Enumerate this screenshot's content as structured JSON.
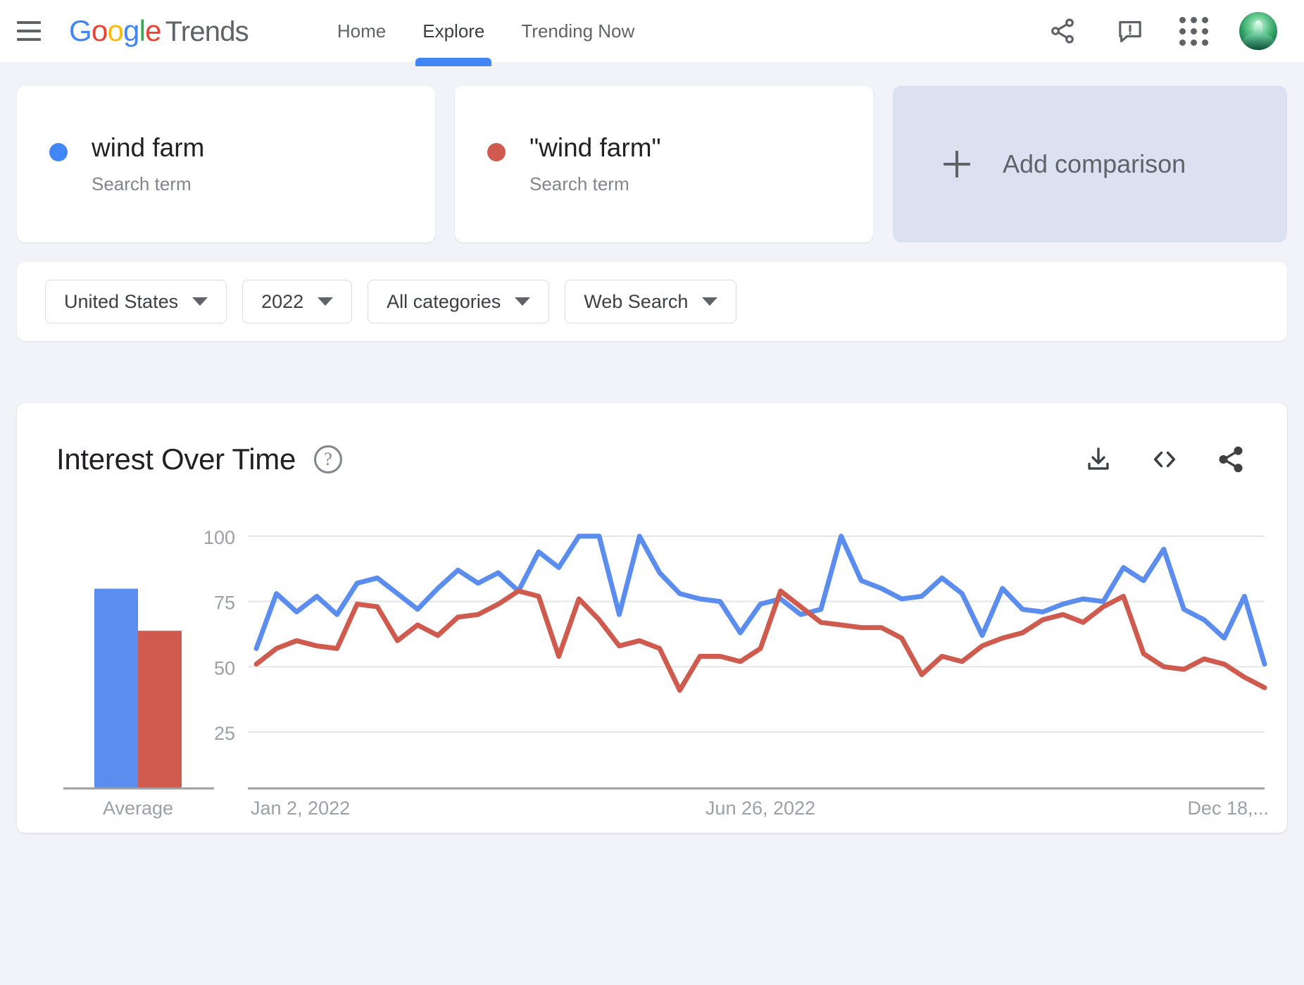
{
  "header": {
    "menu_label": "menu",
    "brand": {
      "g": "G",
      "o1": "o",
      "o2": "o",
      "g2": "g",
      "l": "l",
      "e": "e",
      "suffix": "Trends"
    },
    "tabs": [
      {
        "label": "Home",
        "active": false
      },
      {
        "label": "Explore",
        "active": true
      },
      {
        "label": "Trending Now",
        "active": false
      }
    ],
    "icons": {
      "share": "share-icon",
      "feedback": "feedback-icon",
      "apps": "apps-grid-icon",
      "avatar": "user-avatar"
    }
  },
  "terms": [
    {
      "name": "wind farm",
      "type": "Search term",
      "color": "#4285F4"
    },
    {
      "name": "\"wind farm\"",
      "type": "Search term",
      "color": "#CF5A4E"
    }
  ],
  "add_comparison": {
    "label": "Add comparison"
  },
  "filters": [
    {
      "label": "United States"
    },
    {
      "label": "2022"
    },
    {
      "label": "All categories"
    },
    {
      "label": "Web Search"
    }
  ],
  "chart_panel": {
    "title": "Interest Over Time",
    "help": "?",
    "tools": [
      {
        "name": "download-icon",
        "label": "Download CSV"
      },
      {
        "name": "embed-icon",
        "label": "Embed"
      },
      {
        "name": "share-icon",
        "label": "Share"
      }
    ]
  },
  "chart_data": {
    "type": "line",
    "title": "Interest Over Time",
    "xlabel": "",
    "ylabel": "",
    "ylim": [
      0,
      105
    ],
    "yticks": [
      25,
      50,
      75,
      100
    ],
    "grid": true,
    "legend": "none",
    "xtick_labels": [
      "Jan 2, 2022",
      "Jun 26, 2022",
      "Dec 18,..."
    ],
    "xtick_positions": [
      0,
      25,
      50
    ],
    "x": [
      "Jan 2, 2022",
      "Jan 9, 2022",
      "Jan 16, 2022",
      "Jan 23, 2022",
      "Jan 30, 2022",
      "Feb 6, 2022",
      "Feb 13, 2022",
      "Feb 20, 2022",
      "Feb 27, 2022",
      "Mar 6, 2022",
      "Mar 13, 2022",
      "Mar 20, 2022",
      "Mar 27, 2022",
      "Apr 3, 2022",
      "Apr 10, 2022",
      "Apr 17, 2022",
      "Apr 24, 2022",
      "May 1, 2022",
      "May 8, 2022",
      "May 15, 2022",
      "May 22, 2022",
      "May 29, 2022",
      "Jun 5, 2022",
      "Jun 12, 2022",
      "Jun 19, 2022",
      "Jun 26, 2022",
      "Jul 3, 2022",
      "Jul 10, 2022",
      "Jul 17, 2022",
      "Jul 24, 2022",
      "Jul 31, 2022",
      "Aug 7, 2022",
      "Aug 14, 2022",
      "Aug 21, 2022",
      "Aug 28, 2022",
      "Sep 4, 2022",
      "Sep 11, 2022",
      "Sep 18, 2022",
      "Sep 25, 2022",
      "Oct 2, 2022",
      "Oct 9, 2022",
      "Oct 16, 2022",
      "Oct 23, 2022",
      "Oct 30, 2022",
      "Nov 6, 2022",
      "Nov 13, 2022",
      "Nov 20, 2022",
      "Nov 27, 2022",
      "Dec 4, 2022",
      "Dec 11, 2022",
      "Dec 18, 2022"
    ],
    "series": [
      {
        "name": "wind farm",
        "color": "#5B8DEF",
        "values": [
          57,
          78,
          71,
          77,
          70,
          82,
          84,
          78,
          72,
          80,
          87,
          82,
          86,
          79,
          94,
          88,
          100,
          100,
          70,
          100,
          86,
          78,
          76,
          75,
          63,
          74,
          76,
          70,
          72,
          100,
          83,
          80,
          76,
          77,
          84,
          78,
          62,
          80,
          72,
          71,
          74,
          76,
          75,
          88,
          83,
          95,
          72,
          68,
          61,
          77,
          51
        ]
      },
      {
        "name": "\"wind farm\"",
        "color": "#CF5A4E",
        "values": [
          51,
          57,
          60,
          58,
          57,
          74,
          73,
          60,
          66,
          62,
          69,
          70,
          74,
          79,
          77,
          54,
          76,
          68,
          58,
          60,
          57,
          41,
          54,
          54,
          52,
          57,
          79,
          73,
          67,
          66,
          65,
          65,
          61,
          47,
          54,
          52,
          58,
          61,
          63,
          68,
          70,
          67,
          73,
          77,
          55,
          50,
          49,
          53,
          51,
          46,
          42
        ]
      }
    ],
    "average": {
      "label": "Average",
      "values": [
        76,
        60
      ],
      "colors": [
        "#5B8DEF",
        "#CF5A4E"
      ]
    }
  }
}
